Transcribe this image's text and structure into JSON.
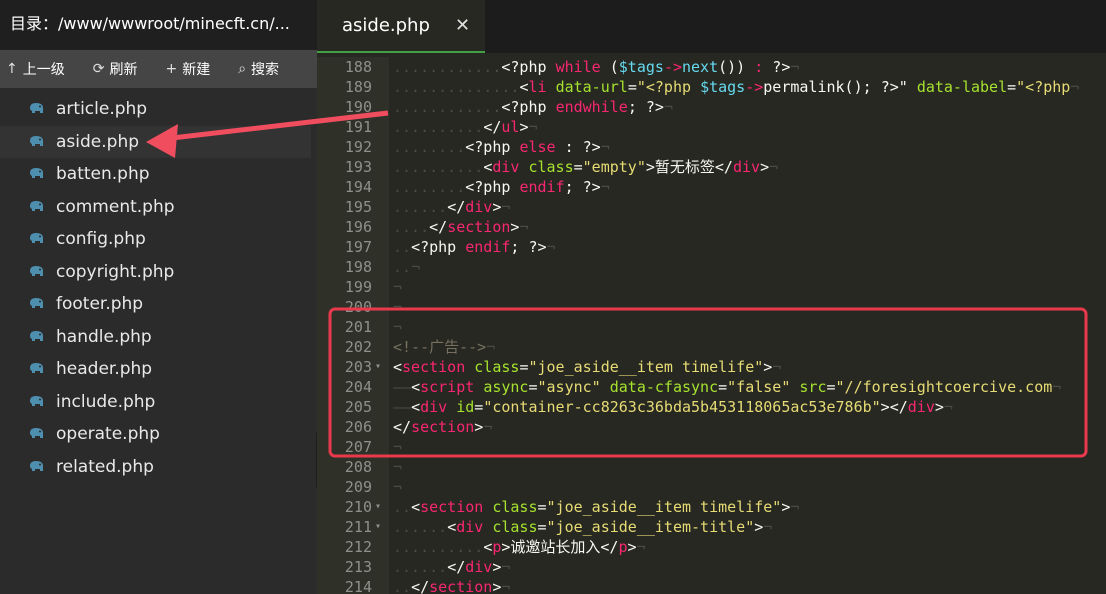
{
  "sidebar": {
    "path": "目录：/www/wwwroot/minecft.cn/...",
    "toolbar": {
      "up": {
        "icon": "arrow-up-icon",
        "label": "上一级"
      },
      "refresh": {
        "icon": "refresh-icon",
        "label": "刷新"
      },
      "new": {
        "icon": "plus-icon",
        "label": "新建"
      },
      "search": {
        "icon": "search-icon",
        "label": "搜索"
      }
    },
    "files": [
      {
        "name": "article.php"
      },
      {
        "name": "aside.php",
        "selected": true
      },
      {
        "name": "batten.php"
      },
      {
        "name": "comment.php"
      },
      {
        "name": "config.php"
      },
      {
        "name": "copyright.php"
      },
      {
        "name": "footer.php"
      },
      {
        "name": "handle.php"
      },
      {
        "name": "header.php"
      },
      {
        "name": "include.php"
      },
      {
        "name": "operate.php"
      },
      {
        "name": "related.php"
      }
    ]
  },
  "editor": {
    "tab": {
      "label": "aside.php",
      "close": "✕"
    },
    "colors": {
      "tag": "#f92672",
      "attr": "#a6e22e",
      "string": "#e6db74",
      "var": "#66d9ef",
      "comment": "#75715e",
      "highlight": "#e8394d",
      "arrow": "#f04d5e"
    },
    "lines": [
      {
        "n": "188",
        "fold": false,
        "indent": "............",
        "code": [
          [
            "op",
            "<?php "
          ],
          [
            "kw",
            "while"
          ],
          [
            "op",
            " ("
          ],
          [
            "vr",
            "$tags"
          ],
          [
            "kw",
            "->"
          ],
          [
            "vr",
            "next"
          ],
          [
            "op",
            "()) "
          ],
          [
            "kw",
            ":"
          ],
          [
            "op",
            " ?>"
          ]
        ]
      },
      {
        "n": "189",
        "fold": false,
        "indent": "..............",
        "code": [
          [
            "op",
            "<"
          ],
          [
            "kw",
            "li"
          ],
          [
            "op",
            " "
          ],
          [
            "at",
            "data-url"
          ],
          [
            "op",
            "="
          ],
          [
            "st",
            "\"<?php "
          ],
          [
            "vr",
            "$tags"
          ],
          [
            "kw",
            "->"
          ],
          [
            "op",
            "permalink(); "
          ],
          [
            "op",
            "?>\""
          ],
          [
            "op",
            " "
          ],
          [
            "at",
            "data-label"
          ],
          [
            "op",
            "="
          ],
          [
            "st",
            "\"<?php"
          ]
        ]
      },
      {
        "n": "190",
        "fold": false,
        "indent": "............",
        "code": [
          [
            "op",
            "<?php "
          ],
          [
            "kw",
            "endwhile"
          ],
          [
            "op",
            "; ?>"
          ]
        ]
      },
      {
        "n": "191",
        "fold": false,
        "indent": "..........",
        "code": [
          [
            "op",
            "</"
          ],
          [
            "kw",
            "ul"
          ],
          [
            "op",
            ">"
          ]
        ]
      },
      {
        "n": "192",
        "fold": false,
        "indent": "........",
        "code": [
          [
            "op",
            "<?php "
          ],
          [
            "kw",
            "else"
          ],
          [
            "op",
            " : ?>"
          ]
        ]
      },
      {
        "n": "193",
        "fold": false,
        "indent": "..........",
        "code": [
          [
            "op",
            "<"
          ],
          [
            "kw",
            "div"
          ],
          [
            "op",
            " "
          ],
          [
            "at",
            "class"
          ],
          [
            "op",
            "="
          ],
          [
            "st",
            "\"empty\""
          ],
          [
            "op",
            ">暂无标签</"
          ],
          [
            "kw",
            "div"
          ],
          [
            "op",
            ">"
          ]
        ]
      },
      {
        "n": "194",
        "fold": false,
        "indent": "........",
        "code": [
          [
            "op",
            "<?php "
          ],
          [
            "kw",
            "endif"
          ],
          [
            "op",
            "; ?>"
          ]
        ]
      },
      {
        "n": "195",
        "fold": false,
        "indent": "......",
        "code": [
          [
            "op",
            "</"
          ],
          [
            "kw",
            "div"
          ],
          [
            "op",
            ">"
          ]
        ]
      },
      {
        "n": "196",
        "fold": false,
        "indent": "....",
        "code": [
          [
            "op",
            "</"
          ],
          [
            "kw",
            "section"
          ],
          [
            "op",
            ">"
          ]
        ]
      },
      {
        "n": "197",
        "fold": false,
        "indent": "..",
        "code": [
          [
            "op",
            "<?php "
          ],
          [
            "kw",
            "endif"
          ],
          [
            "op",
            "; ?>"
          ]
        ]
      },
      {
        "n": "198",
        "fold": false,
        "indent": "..",
        "code": []
      },
      {
        "n": "199",
        "fold": false,
        "indent": "",
        "code": []
      },
      {
        "n": "200",
        "fold": false,
        "indent": "",
        "code": []
      },
      {
        "n": "201",
        "fold": false,
        "indent": "",
        "code": []
      },
      {
        "n": "202",
        "fold": false,
        "indent": "",
        "code": [
          [
            "cm",
            "<!--广告-->"
          ]
        ]
      },
      {
        "n": "203",
        "fold": true,
        "indent": "",
        "code": [
          [
            "op",
            "<"
          ],
          [
            "kw",
            "section"
          ],
          [
            "op",
            " "
          ],
          [
            "at",
            "class"
          ],
          [
            "op",
            "="
          ],
          [
            "st",
            "\"joe_aside__item timelife\""
          ],
          [
            "op",
            ">"
          ]
        ]
      },
      {
        "n": "204",
        "fold": false,
        "indent": "——",
        "code": [
          [
            "op",
            "<"
          ],
          [
            "kw",
            "script"
          ],
          [
            "op",
            " "
          ],
          [
            "at",
            "async"
          ],
          [
            "op",
            "="
          ],
          [
            "st",
            "\"async\""
          ],
          [
            "op",
            " "
          ],
          [
            "at",
            "data-cfasync"
          ],
          [
            "op",
            "="
          ],
          [
            "st",
            "\"false\""
          ],
          [
            "op",
            " "
          ],
          [
            "at",
            "src"
          ],
          [
            "op",
            "="
          ],
          [
            "st",
            "\"//foresightcoercive.com"
          ]
        ]
      },
      {
        "n": "205",
        "fold": false,
        "indent": "——",
        "code": [
          [
            "op",
            "<"
          ],
          [
            "kw",
            "div"
          ],
          [
            "op",
            " "
          ],
          [
            "at",
            "id"
          ],
          [
            "op",
            "="
          ],
          [
            "st",
            "\"container-cc8263c36bda5b453118065ac53e786b\""
          ],
          [
            "op",
            "></"
          ],
          [
            "kw",
            "div"
          ],
          [
            "op",
            ">"
          ]
        ]
      },
      {
        "n": "206",
        "fold": false,
        "indent": "",
        "code": [
          [
            "op",
            "</"
          ],
          [
            "kw",
            "section"
          ],
          [
            "op",
            ">"
          ]
        ]
      },
      {
        "n": "207",
        "fold": false,
        "indent": "",
        "code": []
      },
      {
        "n": "208",
        "fold": false,
        "indent": "",
        "code": []
      },
      {
        "n": "209",
        "fold": false,
        "indent": "",
        "code": []
      },
      {
        "n": "210",
        "fold": true,
        "indent": "..",
        "code": [
          [
            "op",
            "<"
          ],
          [
            "kw",
            "section"
          ],
          [
            "op",
            " "
          ],
          [
            "at",
            "class"
          ],
          [
            "op",
            "="
          ],
          [
            "st",
            "\"joe_aside__item timelife\""
          ],
          [
            "op",
            ">"
          ]
        ]
      },
      {
        "n": "211",
        "fold": true,
        "indent": "......",
        "code": [
          [
            "op",
            "<"
          ],
          [
            "kw",
            "div"
          ],
          [
            "op",
            " "
          ],
          [
            "at",
            "class"
          ],
          [
            "op",
            "="
          ],
          [
            "st",
            "\"joe_aside__item-title\""
          ],
          [
            "op",
            ">"
          ]
        ]
      },
      {
        "n": "212",
        "fold": false,
        "indent": "..........",
        "code": [
          [
            "op",
            "<"
          ],
          [
            "kw",
            "p"
          ],
          [
            "op",
            ">诚邀站长加入</"
          ],
          [
            "kw",
            "p"
          ],
          [
            "op",
            ">"
          ]
        ]
      },
      {
        "n": "213",
        "fold": false,
        "indent": "......",
        "code": [
          [
            "op",
            "</"
          ],
          [
            "kw",
            "div"
          ],
          [
            "op",
            ">"
          ]
        ]
      },
      {
        "n": "214",
        "fold": false,
        "indent": "..",
        "code": [
          [
            "op",
            "</"
          ],
          [
            "kw",
            "section"
          ],
          [
            "op",
            ">"
          ]
        ]
      }
    ]
  }
}
